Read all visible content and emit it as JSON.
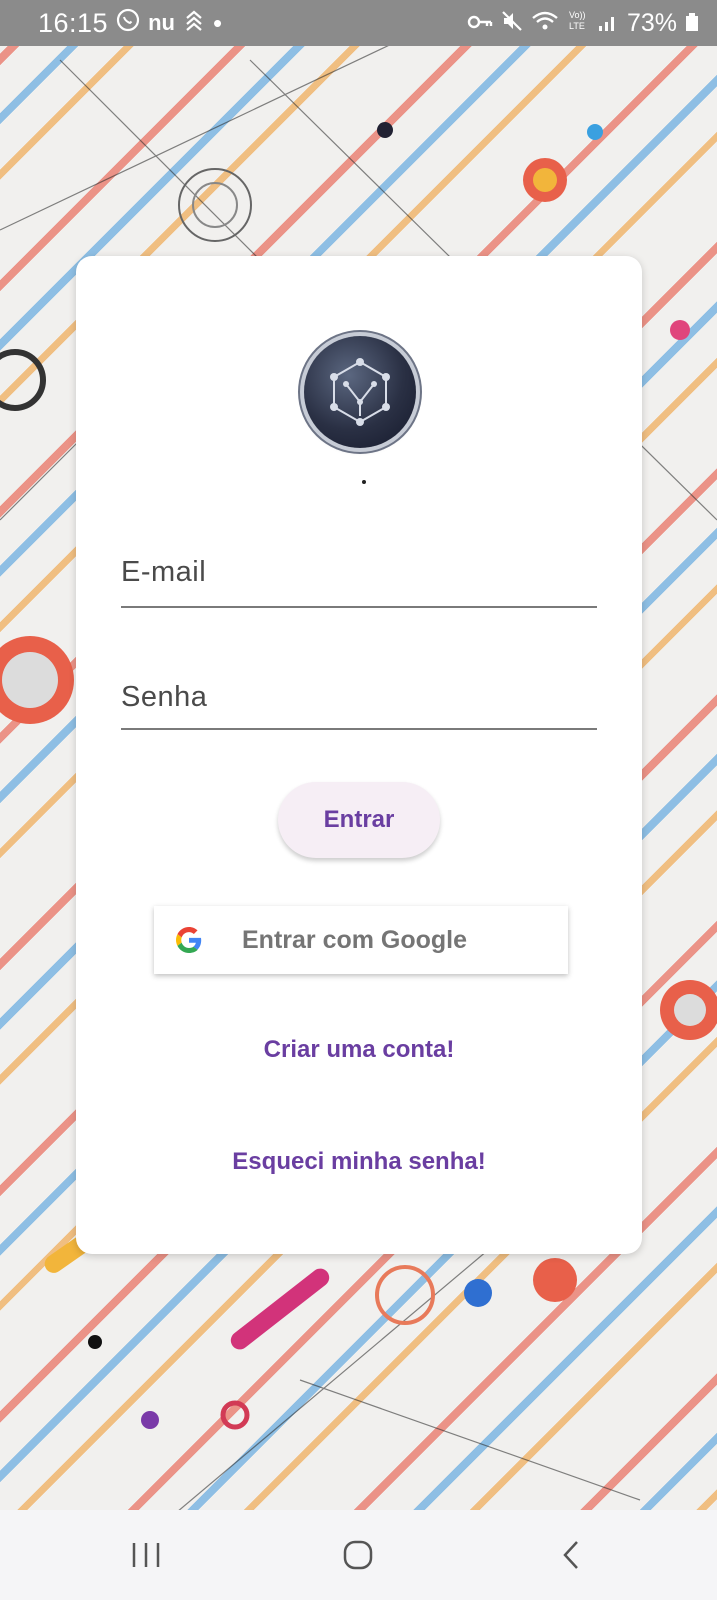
{
  "status_bar": {
    "time": "16:15",
    "app_icons": [
      "whatsapp-icon",
      "nubank-icon",
      "binance-icon"
    ],
    "notification_dot": "•",
    "carrier_badge": "nu",
    "volte": "VoLTE",
    "battery": "73%"
  },
  "login": {
    "email_placeholder": "E-mail",
    "password_placeholder": "Senha",
    "login_button": "Entrar",
    "google_button": "Entrar com Google",
    "create_account": "Criar uma conta!",
    "forgot_password": "Esqueci minha senha!"
  },
  "colors": {
    "accent": "#6a3ea1",
    "button_bg": "#f6eef5",
    "status_bar_bg": "#8b8b8b"
  }
}
